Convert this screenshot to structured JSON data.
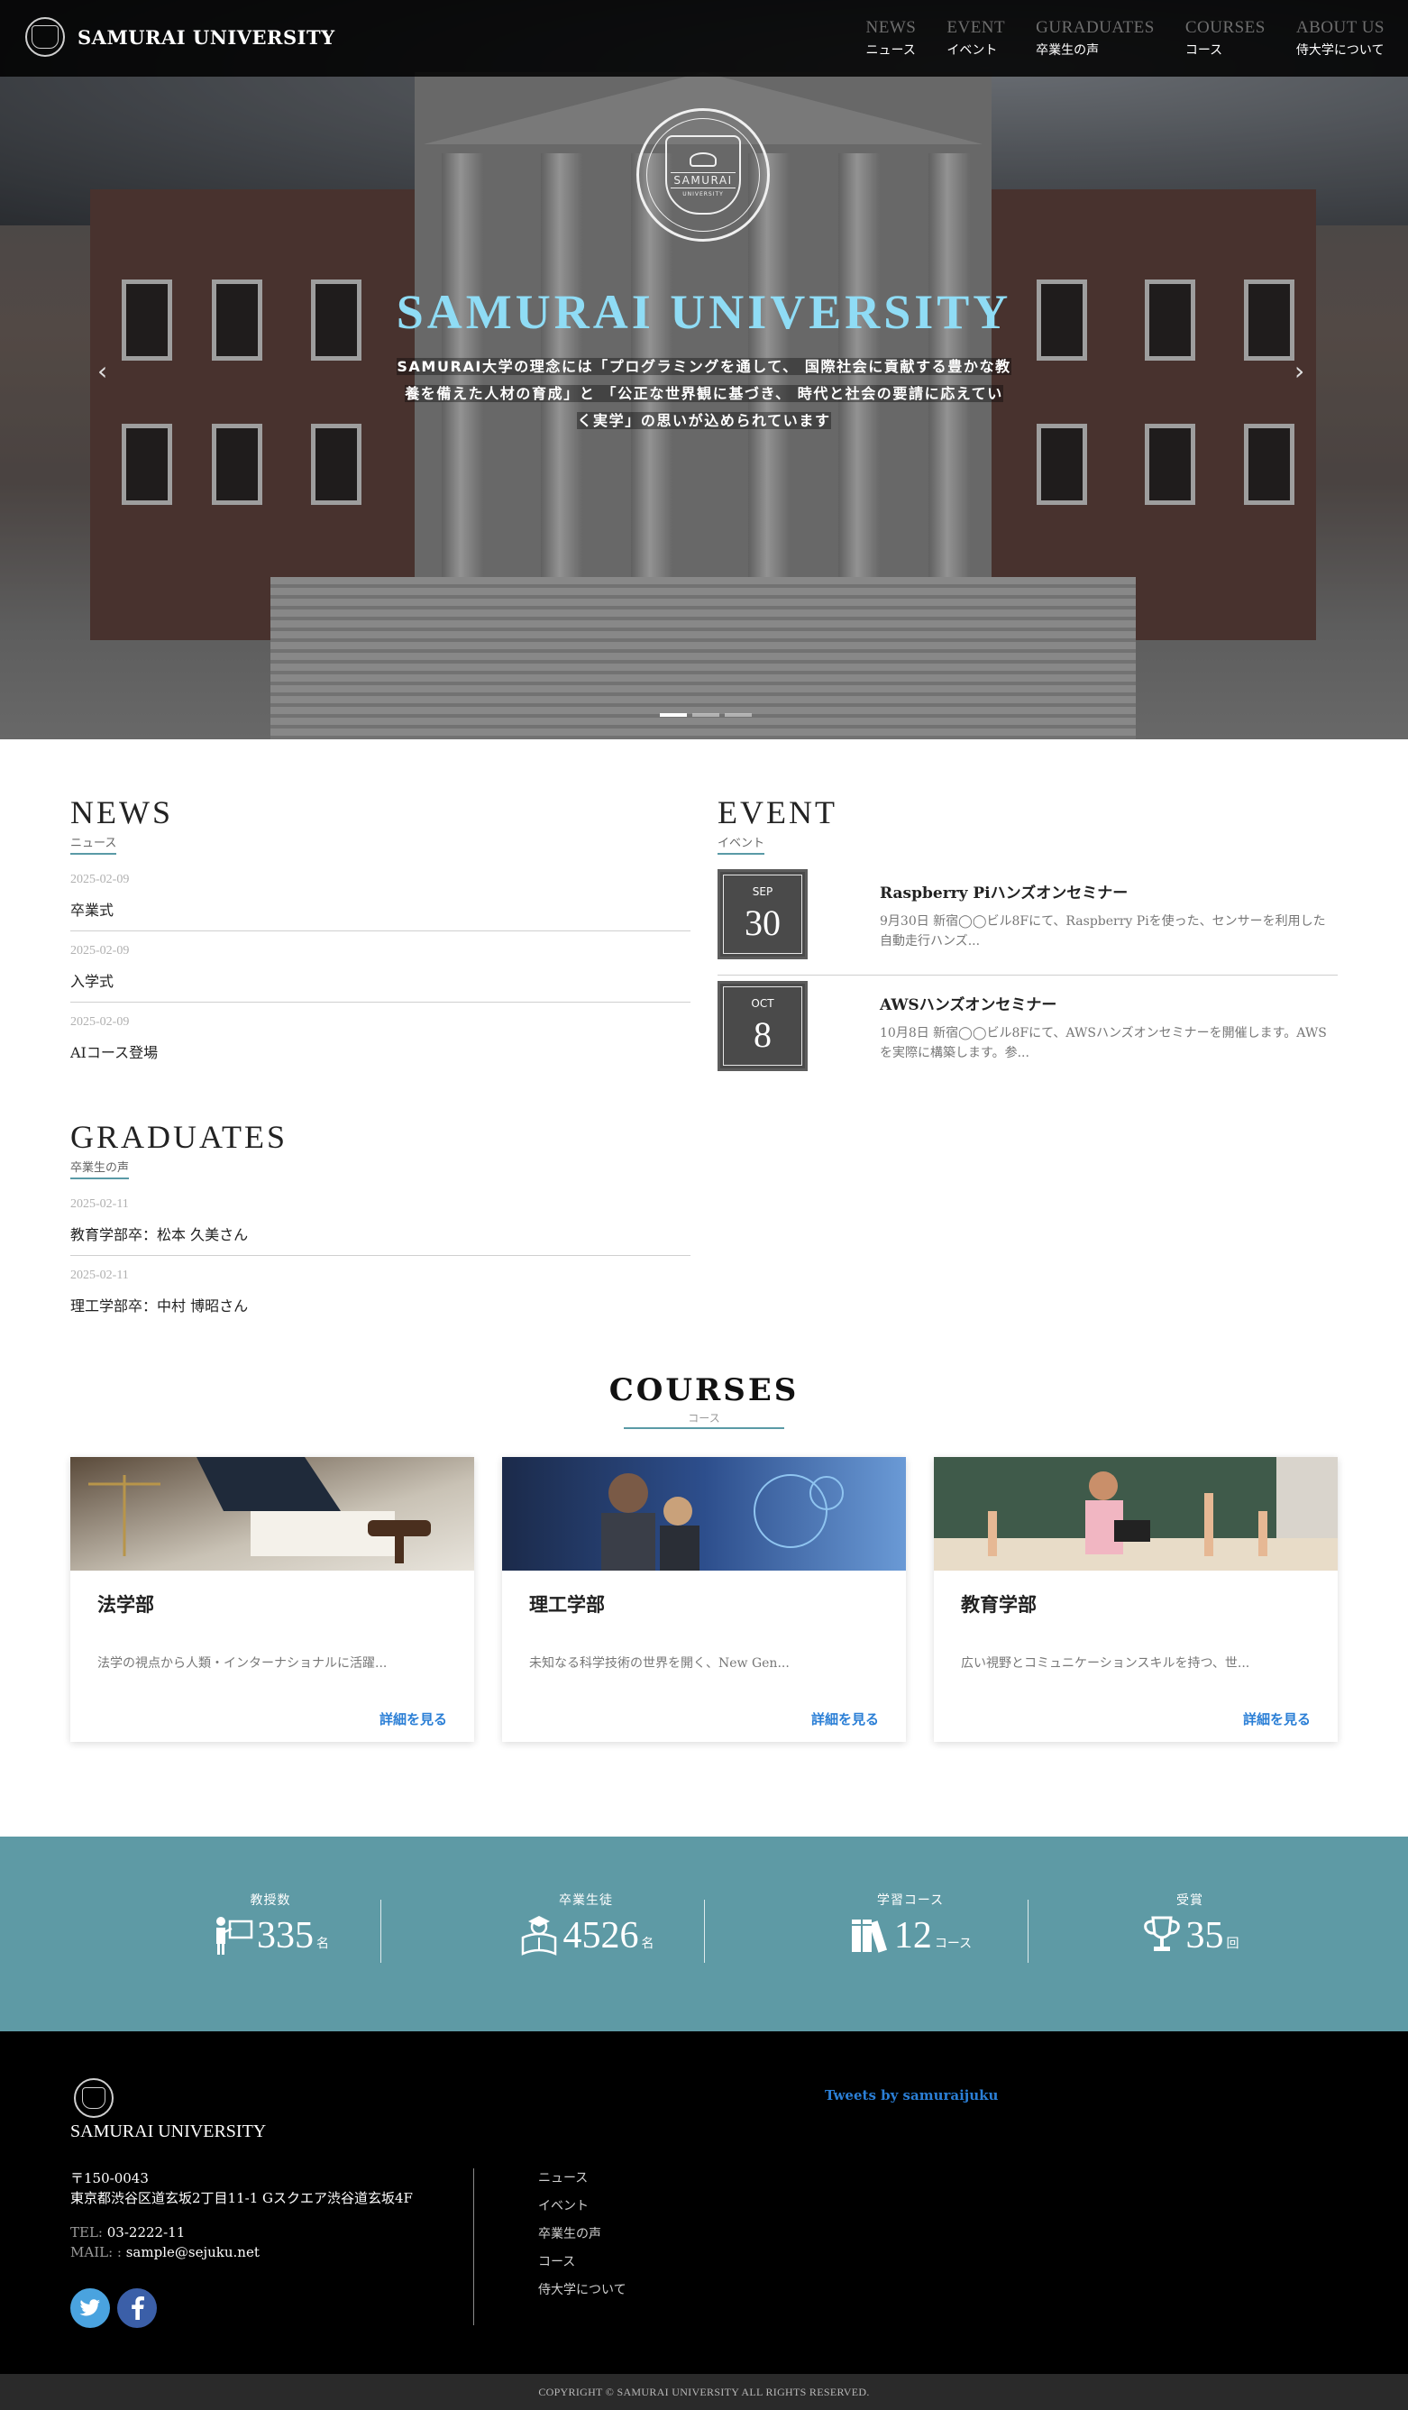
{
  "header": {
    "brand": "SAMURAI UNIVERSITY",
    "nav": [
      {
        "en": "NEWS",
        "jp": "ニュース"
      },
      {
        "en": "EVENT",
        "jp": "イベント"
      },
      {
        "en": "GURADUATES",
        "jp": "卒業生の声"
      },
      {
        "en": "COURSES",
        "jp": "コース"
      },
      {
        "en": "ABOUT US",
        "jp": "侍大学について"
      }
    ]
  },
  "hero": {
    "emblem_text": "SAMURAI",
    "emblem_sub": "UNIVERSITY",
    "title": "SAMURAI UNIVERSITY",
    "desc_lines": [
      "SAMURAI大学の理念には「プログラミングを通して、 国際社会に貢献する豊かな教",
      "養を備えた人材の育成」と 「公正な世界観に基づき、 時代と社会の要請に応えてい",
      "く実学」の思いが込められています"
    ],
    "prev_arrow": "‹",
    "next_arrow": "›",
    "slides": 3,
    "active_slide": 0
  },
  "news": {
    "title": "NEWS",
    "subtitle": "ニュース",
    "posts": [
      {
        "date": "2025-02-09",
        "title": "卒業式"
      },
      {
        "date": "2025-02-09",
        "title": "入学式"
      },
      {
        "date": "2025-02-09",
        "title": "AIコース登場"
      }
    ]
  },
  "event": {
    "title": "EVENT",
    "subtitle": "イベント",
    "items": [
      {
        "month": "SEP",
        "day": "30",
        "title": "Raspberry Piハンズオンセミナー",
        "desc": "9月30日 新宿◯◯ビル8Fにて、Raspberry Piを使った、センサーを利用した自動走行ハンズ..."
      },
      {
        "month": "OCT",
        "day": "8",
        "title": "AWSハンズオンセミナー",
        "desc": "10月8日 新宿◯◯ビル8Fにて、AWSハンズオンセミナーを開催します。AWSを実際に構築します。参..."
      }
    ]
  },
  "graduates": {
    "title": "GRADUATES",
    "subtitle": "卒業生の声",
    "posts": [
      {
        "date": "2025-02-11",
        "title": "教育学部卒：松本 久美さん"
      },
      {
        "date": "2025-02-11",
        "title": "理工学部卒：中村 博昭さん"
      }
    ]
  },
  "courses": {
    "title": "COURSES",
    "subtitle": "コース",
    "cards": [
      {
        "title": "法学部",
        "desc": "法学の視点から人類・インターナショナルに活躍...",
        "link": "詳細を見る"
      },
      {
        "title": "理工学部",
        "desc": "未知なる科学技術の世界を開く、New Gen...",
        "link": "詳細を見る"
      },
      {
        "title": "教育学部",
        "desc": "広い視野とコミュニケーションスキルを持つ、世...",
        "link": "詳細を見る"
      }
    ]
  },
  "stats": [
    {
      "label": "教授数",
      "value": "335",
      "unit": "名",
      "icon": "professor-icon"
    },
    {
      "label": "卒業生徒",
      "value": "4526",
      "unit": "名",
      "icon": "graduate-icon"
    },
    {
      "label": "学習コース",
      "value": "12",
      "unit": "コース",
      "icon": "books-icon"
    },
    {
      "label": "受賞",
      "value": "35",
      "unit": "回",
      "icon": "trophy-icon"
    }
  ],
  "footer": {
    "name": "SAMURAI UNIVERSITY",
    "postal": "〒150-0043",
    "address": "東京都渋谷区道玄坂2丁目11-1 Gスクエア渋谷道玄坂4F",
    "tel_label": "TEL:",
    "tel": "03-2222-11",
    "mail_label": "MAIL: :",
    "mail": "sample@sejuku.net",
    "links": [
      "ニュース",
      "イベント",
      "卒業生の声",
      "コース",
      "侍大学について"
    ],
    "tweets": "Tweets by samuraijuku",
    "copyright": "COPYRIGHT © SAMURAI UNIVERSITY ALL RIGHTS RESERVED."
  },
  "colors": {
    "accent": "#5e9aa5",
    "hero_title": "#8fdcf5",
    "link": "#2b7fd6",
    "twitter": "#4aa3df",
    "facebook": "#3b5fa8"
  }
}
